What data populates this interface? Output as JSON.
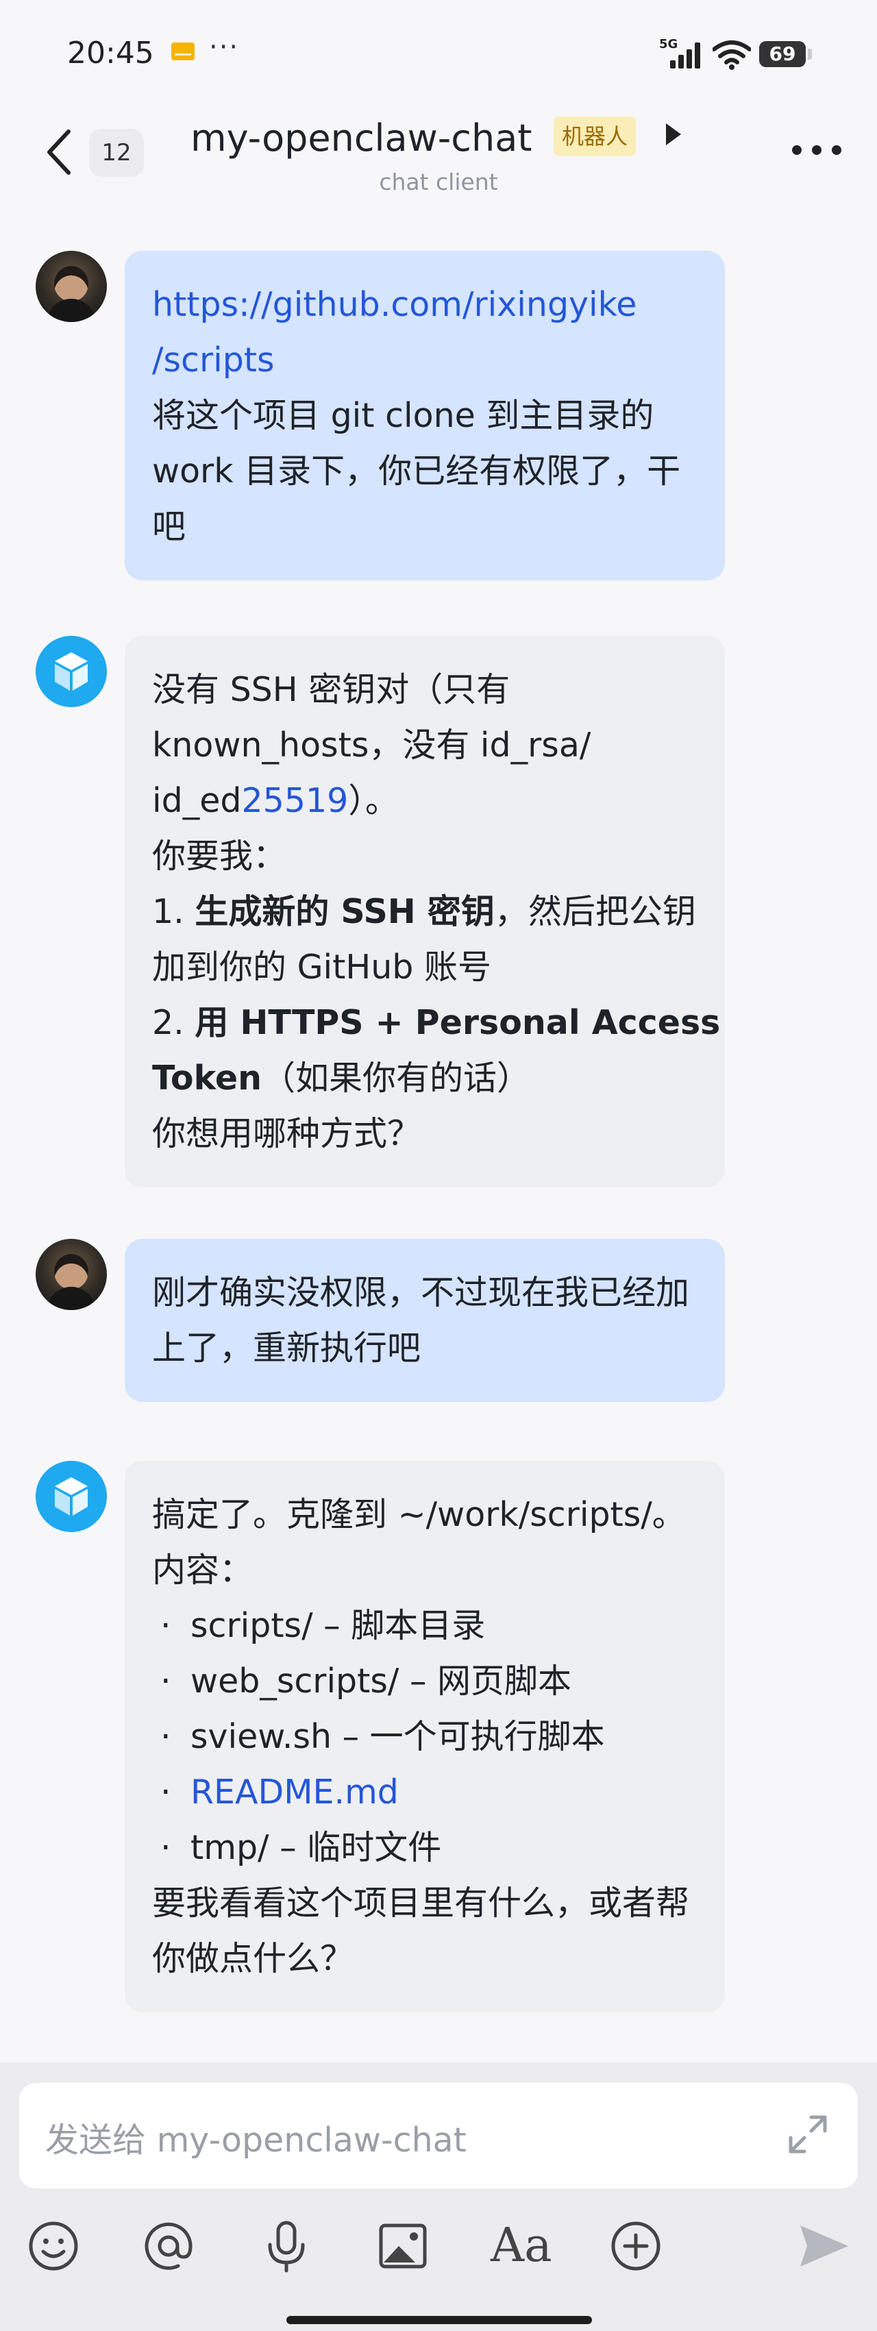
{
  "status_bar": {
    "time": "20:45",
    "network": "5G",
    "battery": "69"
  },
  "header": {
    "unread_count": "12",
    "title": "my-openclaw-chat",
    "badge": "机器人",
    "subtitle": "chat client"
  },
  "messages": [
    {
      "sender": "user",
      "lines": [
        {
          "parts": [
            {
              "text": "https://github.com/rixingyike",
              "link": true
            }
          ]
        },
        {
          "parts": [
            {
              "text": "/scripts",
              "link": true
            }
          ]
        },
        {
          "parts": [
            {
              "text": "将这个项目 git clone 到主目录的"
            }
          ]
        },
        {
          "parts": [
            {
              "text": "work 目录下，你已经有权限了，干"
            }
          ]
        },
        {
          "parts": [
            {
              "text": "吧"
            }
          ]
        }
      ]
    },
    {
      "sender": "bot",
      "lines": [
        {
          "parts": [
            {
              "text": "没有 SSH 密钥对（只有"
            }
          ]
        },
        {
          "parts": [
            {
              "text": "known_hosts，没有 id_rsa/"
            }
          ]
        },
        {
          "parts": [
            {
              "text": "id_ed"
            },
            {
              "text": "25519",
              "link": true
            },
            {
              "text": "）。"
            }
          ]
        },
        {
          "parts": [
            {
              "text": "你要我："
            }
          ]
        },
        {
          "parts": [
            {
              "text": "1. "
            },
            {
              "text": "生成新的 SSH 密钥",
              "bold": true
            },
            {
              "text": "，然后把公钥"
            }
          ]
        },
        {
          "parts": [
            {
              "text": "加到你的 GitHub 账号"
            }
          ]
        },
        {
          "parts": [
            {
              "text": "2. "
            },
            {
              "text": "用 HTTPS + Personal Access",
              "bold": true
            }
          ]
        },
        {
          "parts": [
            {
              "text": "Token",
              "bold": true
            },
            {
              "text": "（如果你有的话）"
            }
          ]
        },
        {
          "parts": [
            {
              "text": "你想用哪种方式？"
            }
          ]
        }
      ]
    },
    {
      "sender": "user",
      "lines": [
        {
          "parts": [
            {
              "text": "刚才确实没权限，不过现在我已经加"
            }
          ]
        },
        {
          "parts": [
            {
              "text": "上了，重新执行吧"
            }
          ]
        }
      ]
    },
    {
      "sender": "bot",
      "lines": [
        {
          "parts": [
            {
              "text": "搞定了。克隆到 ~/work/scripts/。"
            }
          ]
        },
        {
          "parts": [
            {
              "text": "内容："
            }
          ]
        },
        {
          "bullet": true,
          "parts": [
            {
              "text": "scripts/ – 脚本目录"
            }
          ]
        },
        {
          "bullet": true,
          "parts": [
            {
              "text": "web_scripts/ – 网页脚本"
            }
          ]
        },
        {
          "bullet": true,
          "parts": [
            {
              "text": "sview.sh – 一个可执行脚本"
            }
          ]
        },
        {
          "bullet": true,
          "parts": [
            {
              "text": "README.md",
              "link": true
            }
          ]
        },
        {
          "bullet": true,
          "parts": [
            {
              "text": "tmp/ – 临时文件"
            }
          ]
        },
        {
          "parts": [
            {
              "text": "要我看看这个项目里有什么，或者帮"
            }
          ]
        },
        {
          "parts": [
            {
              "text": "你做点什么？"
            }
          ]
        }
      ]
    }
  ],
  "composer": {
    "placeholder": "发送给 my-openclaw-chat",
    "toolbar_icons": [
      "emoji-icon",
      "mention-icon",
      "microphone-icon",
      "image-icon",
      "text-format-icon",
      "add-icon",
      "send-icon"
    ],
    "format_label": "Aa"
  },
  "colors": {
    "user_bubble": "#d5e4ff",
    "bot_bubble": "#eeeff2",
    "link": "#2456d6",
    "bot_avatar": "#1fa9ef"
  }
}
